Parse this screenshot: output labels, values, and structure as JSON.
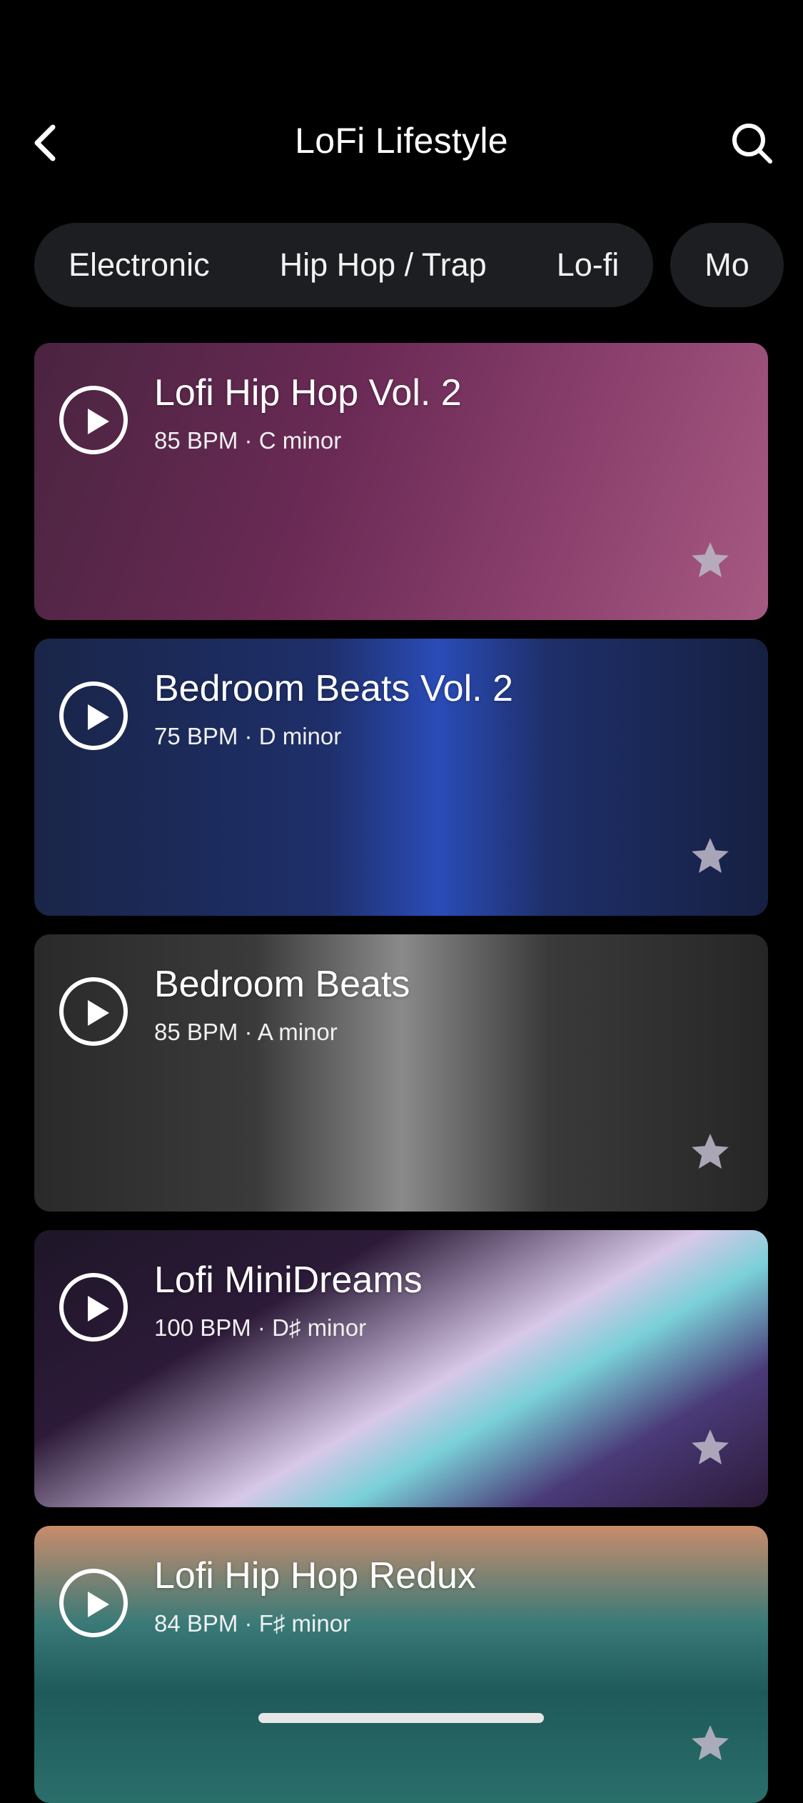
{
  "header": {
    "title": "LoFi Lifestyle",
    "back_icon": "chevron-left-icon",
    "search_icon": "search-icon"
  },
  "chips": {
    "group": [
      "Electronic",
      "Hip Hop / Trap",
      "Lo-fi"
    ],
    "next": "Mo"
  },
  "cards": [
    {
      "title": "Lofi Hip Hop Vol. 2",
      "subtitle": "85 BPM · C minor"
    },
    {
      "title": "Bedroom Beats Vol. 2",
      "subtitle": "75 BPM · D minor"
    },
    {
      "title": "Bedroom Beats",
      "subtitle": "85 BPM · A minor"
    },
    {
      "title": "Lofi MiniDreams",
      "subtitle": "100 BPM · D♯ minor"
    },
    {
      "title": "Lofi Hip Hop Redux",
      "subtitle": "84 BPM · F♯ minor"
    }
  ]
}
